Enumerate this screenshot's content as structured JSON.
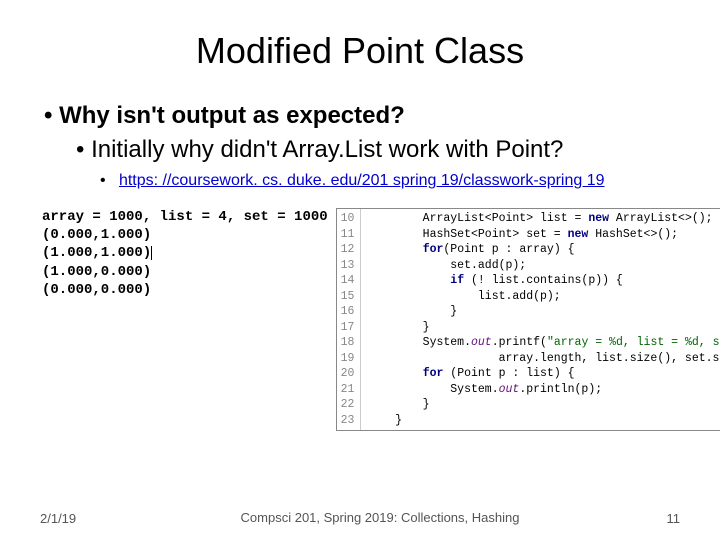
{
  "title": "Modified Point Class",
  "bullets": {
    "b1": "Why isn't output as expected?",
    "b2": "Initially why didn't Array.List work with Point?",
    "b3_link": "https: //coursework. cs. duke. edu/201 spring 19/classwork-spring 19"
  },
  "output": {
    "line1": "array = 1000, list = 4, set = 1000",
    "line2": "(0.000,1.000)",
    "line3": "(1.000,1.000)",
    "line4": "(1.000,0.000)",
    "line5": "(0.000,0.000)"
  },
  "code": {
    "gutter": "10\n11\n12\n13\n14\n15\n16\n17\n18\n19\n20\n21\n22\n23",
    "l10a": "        ArrayList<Point> list = ",
    "l10b": "new",
    "l10c": " ArrayList<>();",
    "l11a": "        HashSet<Point> set = ",
    "l11b": "new",
    "l11c": " HashSet<>();",
    "l12a": "        ",
    "l12b": "for",
    "l12c": "(Point p : array) {",
    "l13": "            set.add(p);",
    "l14a": "            ",
    "l14b": "if",
    "l14c": " (! list.contains(p)) {",
    "l15": "                list.add(p);",
    "l16": "            }",
    "l17": "        }",
    "l18a": "        System.",
    "l18b": "out",
    "l18c": ".printf(",
    "l18d": "\"array = %d, list = %d, set = %d\\n\"",
    "l18e": ",",
    "l19": "                   array.length, list.size(), set.size());",
    "l20a": "        ",
    "l20b": "for",
    "l20c": " (Point p : list) {",
    "l21a": "            System.",
    "l21b": "out",
    "l21c": ".println(p);",
    "l22": "        }",
    "l23": "    }"
  },
  "footer": {
    "date": "2/1/19",
    "center": "Compsci 201, Spring 2019: Collections, Hashing",
    "page": "11"
  }
}
